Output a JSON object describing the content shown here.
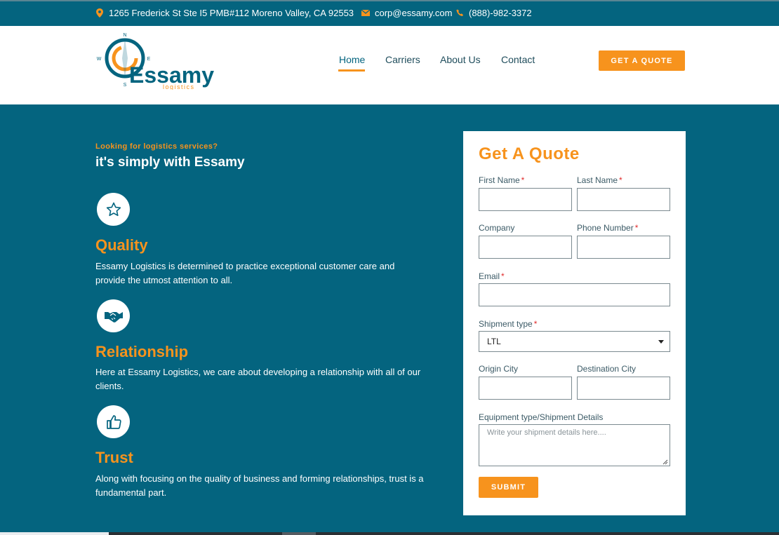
{
  "topbar": {
    "address": "1265 Frederick St Ste I5 PMB#112 Moreno Valley, CA 92553",
    "email": "corp@essamy.com",
    "phone": "(888)-982-3372",
    "icons": [
      "map-marker-icon",
      "envelope-icon",
      "phone-icon"
    ]
  },
  "logo": {
    "brand": "Essamy",
    "sub": "logistics",
    "compass": {
      "n": "N",
      "w": "W",
      "e": "E",
      "s": "S"
    }
  },
  "nav": {
    "items": [
      {
        "label": "Home",
        "active": true
      },
      {
        "label": "Carriers",
        "active": false
      },
      {
        "label": "About Us",
        "active": false
      },
      {
        "label": "Contact",
        "active": false
      }
    ],
    "cta": "GET A QUOTE"
  },
  "hero": {
    "tagline": "Looking for logistics services?",
    "headline": "it's simply with Essamy",
    "features": [
      {
        "icon": "star-icon",
        "title": "Quality",
        "text": "Essamy Logistics is determined to practice exceptional customer care and provide the utmost attention to all."
      },
      {
        "icon": "handshake-icon",
        "title": "Relationship",
        "text": "Here at Essamy Logistics, we care about developing a relationship with all of our clients."
      },
      {
        "icon": "thumbs-up-icon",
        "title": "Trust",
        "text": "Along with focusing on the quality of business and forming relationships, trust is a fundamental part."
      }
    ]
  },
  "form": {
    "title": "Get A Quote",
    "first_name": "First Name",
    "last_name": "Last Name",
    "company": "Company",
    "phone_number": "Phone Number",
    "email": "Email",
    "shipment_type": "Shipment type",
    "shipment_value": "LTL",
    "origin_city": "Origin City",
    "destination_city": "Destination City",
    "details_label": "Equipment type/Shipment Details",
    "details_placeholder": "Write your shipment details here....",
    "required_mark": "*",
    "submit": "SUBMIT"
  },
  "colors": {
    "primary": "#04647f",
    "accent": "#f7931d",
    "text_dark": "#1f4d5c"
  }
}
